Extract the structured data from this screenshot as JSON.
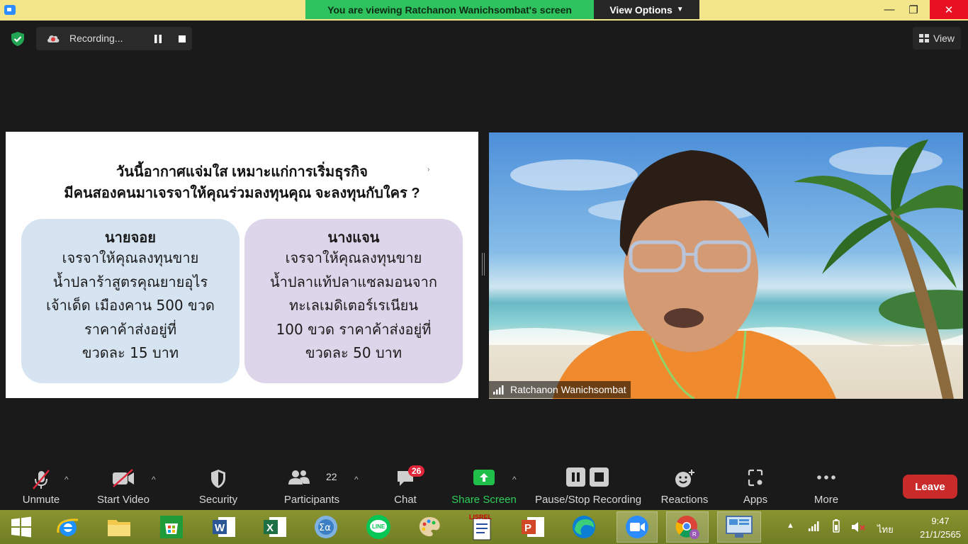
{
  "titlebar": {
    "banner_text": "You are viewing Ratchanon Wanichsombat's screen",
    "view_options": "View Options",
    "controls": {
      "minimize": "—",
      "maximize": "❐",
      "close": "✕"
    }
  },
  "recording": {
    "label": "Recording..."
  },
  "view_button": {
    "label": "View"
  },
  "slide": {
    "question_line1": "วันนี้อากาศแจ่มใส เหมาะแก่การเริ่มธุรกิจ",
    "question_line2": "มีคนสองคนมาเจรจาให้คุณร่วมลงทุนคุณ จะลงทุนกับใคร ?",
    "left_card": {
      "name": "นายจอย",
      "lines": [
        "เจรจาให้คุณลงทุนขาย",
        "น้ำปลาร้าสูตรคุณยายอุไร",
        "เจ้าเด็ด เมืองคาน 500 ขวด",
        "ราคาค้าส่งอยู่ที่",
        "ขวดละ 15 บาท"
      ]
    },
    "right_card": {
      "name": "นางแจน",
      "lines": [
        "เจรจาให้คุณลงทุนขาย",
        "น้ำปลาแท้ปลาแซลมอนจาก",
        "ทะเลเมดิเตอร์เรเนียน",
        "100 ขวด ราคาค้าส่งอยู่ที่",
        "ขวดละ 50 บาท"
      ]
    }
  },
  "video": {
    "participant_name": "Ratchanon Wanichsombat"
  },
  "toolbar": {
    "unmute": "Unmute",
    "start_video": "Start Video",
    "security": "Security",
    "participants": "Participants",
    "participants_count": "22",
    "chat": "Chat",
    "chat_badge": "26",
    "share_screen": "Share Screen",
    "pause_stop_recording": "Pause/Stop Recording",
    "reactions": "Reactions",
    "apps": "Apps",
    "more": "More",
    "leave": "Leave"
  },
  "taskbar": {
    "language": "ไทย",
    "time": "9:47",
    "date": "21/1/2565",
    "lisrel_label": "LISREL"
  },
  "colors": {
    "banner_green": "#2ec35f",
    "share_green": "#1fbf4a",
    "leave_red": "#c92b2b",
    "titlebar_yellow": "#f2e58a",
    "taskbar_olive": "#7c8a2a"
  }
}
